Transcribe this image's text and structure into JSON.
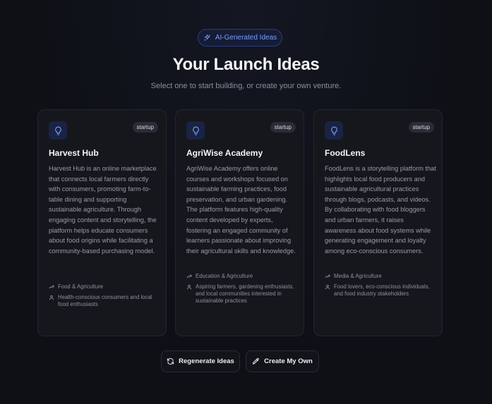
{
  "header": {
    "badge_label": "AI-Generated Ideas",
    "title": "Your Launch Ideas",
    "subtitle": "Select one to start building, or create your own venture."
  },
  "cards": [
    {
      "tag": "startup",
      "title": "Harvest Hub",
      "description": "Harvest Hub is an online marketplace that connects local farmers directly with consumers, promoting farm-to-table dining and supporting sustainable agriculture. Through engaging content and storytelling, the platform helps educate consumers about food origins while facilitating a community-based purchasing model.",
      "industry": "Food & Agriculture",
      "audience": "Health-conscious consumers and local food enthusiasts"
    },
    {
      "tag": "startup",
      "title": "AgriWise Academy",
      "description": "AgriWise Academy offers online courses and workshops focused on sustainable farming practices, food preservation, and urban gardening. The platform features high-quality content developed by experts, fostering an engaged community of learners passionate about improving their agricultural skills and knowledge.",
      "industry": "Education & Agriculture",
      "audience": "Aspiring farmers, gardening enthusiasts, and local communities interested in sustainable practices"
    },
    {
      "tag": "startup",
      "title": "FoodLens",
      "description": "FoodLens is a storytelling platform that highlights local food producers and sustainable agricultural practices through blogs, podcasts, and videos. By collaborating with food bloggers and urban farmers, it raises awareness about food systems while generating engagement and loyalty among eco-conscious consumers.",
      "industry": "Media & Agriculture",
      "audience": "Food lovers, eco-conscious individuals, and food industry stakeholders"
    }
  ],
  "actions": {
    "regenerate_label": "Regenerate Ideas",
    "create_label": "Create My Own"
  },
  "icons": {
    "badge": "sparkles-icon",
    "card": "lightbulb-icon",
    "industry": "trending-up-icon",
    "audience": "user-icon",
    "regenerate": "refresh-icon",
    "create": "pencil-icon"
  },
  "colors": {
    "background": "#0e1016",
    "card_background": "#15171d",
    "accent": "#7e9cf5"
  }
}
